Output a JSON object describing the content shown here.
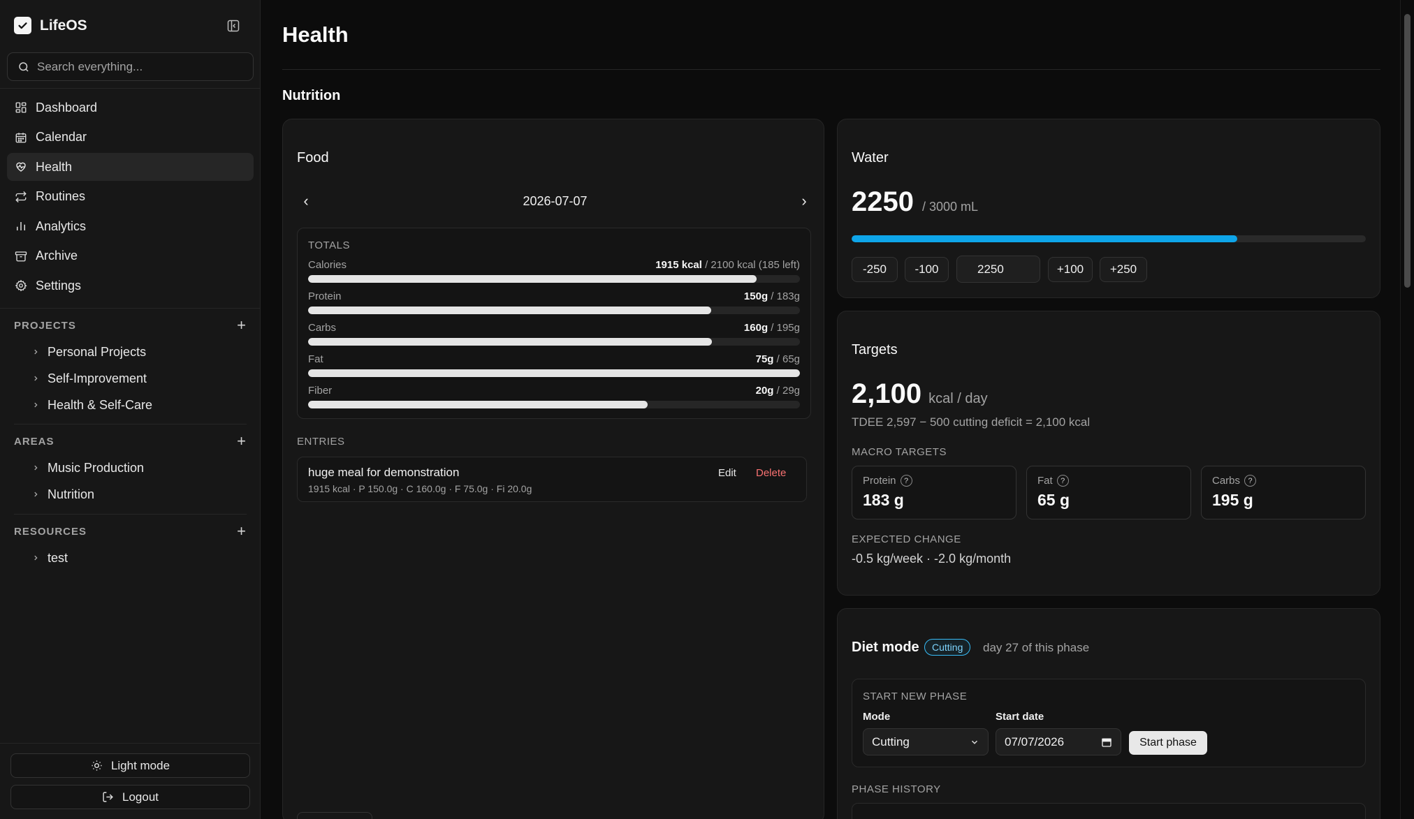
{
  "app": {
    "name": "LifeOS"
  },
  "search": {
    "placeholder": "Search everything..."
  },
  "nav": {
    "items": [
      {
        "label": "Dashboard",
        "icon": "dashboard-icon"
      },
      {
        "label": "Calendar",
        "icon": "calendar-icon"
      },
      {
        "label": "Health",
        "icon": "heart-pulse-icon",
        "active": true
      },
      {
        "label": "Routines",
        "icon": "repeat-icon"
      },
      {
        "label": "Analytics",
        "icon": "bar-chart-icon"
      },
      {
        "label": "Archive",
        "icon": "archive-icon"
      },
      {
        "label": "Settings",
        "icon": "gear-icon"
      }
    ]
  },
  "projects": {
    "title": "PROJECTS",
    "items": [
      "Personal Projects",
      "Self-Improvement",
      "Health & Self-Care"
    ]
  },
  "areas": {
    "title": "AREAS",
    "items": [
      "Music Production",
      "Nutrition"
    ]
  },
  "resources": {
    "title": "RESOURCES",
    "items": [
      "test"
    ]
  },
  "sidebar_bottom": {
    "theme_label": "Light mode",
    "logout_label": "Logout"
  },
  "page": {
    "title": "Health",
    "section": "Nutrition"
  },
  "food": {
    "title": "Food",
    "date": "2026-07-07",
    "prev_label": "‹",
    "next_label": "›",
    "totals_label": "TOTALS",
    "macros": [
      {
        "name": "Calories",
        "value": "1915 kcal",
        "suffix": " / 2100 kcal (185 left)",
        "fraction": 0.912
      },
      {
        "name": "Protein",
        "value": "150g",
        "suffix": " / 183g",
        "fraction": 0.82
      },
      {
        "name": "Carbs",
        "value": "160g",
        "suffix": " / 195g",
        "fraction": 0.821
      },
      {
        "name": "Fat",
        "value": "75g",
        "suffix": " / 65g",
        "fraction": 1.0
      },
      {
        "name": "Fiber",
        "value": "20g",
        "suffix": " / 29g",
        "fraction": 0.69
      }
    ],
    "entries_label": "ENTRIES",
    "entries": [
      {
        "name": "huge meal for demonstration",
        "meta": "1915 kcal · P 150.0g · C 160.0g · F 75.0g · Fi 20.0g",
        "edit_label": "Edit",
        "delete_label": "Delete"
      }
    ]
  },
  "water": {
    "title": "Water",
    "current": "2250",
    "goal_text": "/ 3000 mL",
    "fraction": 0.75,
    "buttons": [
      "-250",
      "-100",
      "+100",
      "+250"
    ],
    "input_value": "2250",
    "accent": "#0ea5e9"
  },
  "targets": {
    "title": "Targets",
    "kcal": "2,100",
    "kcal_unit": "kcal / day",
    "formula": "TDEE 2,597 − 500 cutting deficit = 2,100 kcal",
    "macro_label": "MACRO TARGETS",
    "macros": [
      {
        "label": "Protein",
        "value": "183 g"
      },
      {
        "label": "Fat",
        "value": "65 g"
      },
      {
        "label": "Carbs",
        "value": "195 g"
      }
    ],
    "help_glyph": "?",
    "change_label": "EXPECTED CHANGE",
    "change_value": "-0.5 kg/week · -2.0 kg/month"
  },
  "diet": {
    "title": "Diet mode",
    "badge": "Cutting",
    "badge_color": "#38bdf8",
    "day_text": "day 27 of this phase",
    "new_phase_label": "START NEW PHASE",
    "mode_label": "Mode",
    "mode_value": "Cutting",
    "start_date_label": "Start date",
    "start_date_value": "07/07/2026",
    "start_button": "Start phase",
    "history_label": "PHASE HISTORY"
  }
}
